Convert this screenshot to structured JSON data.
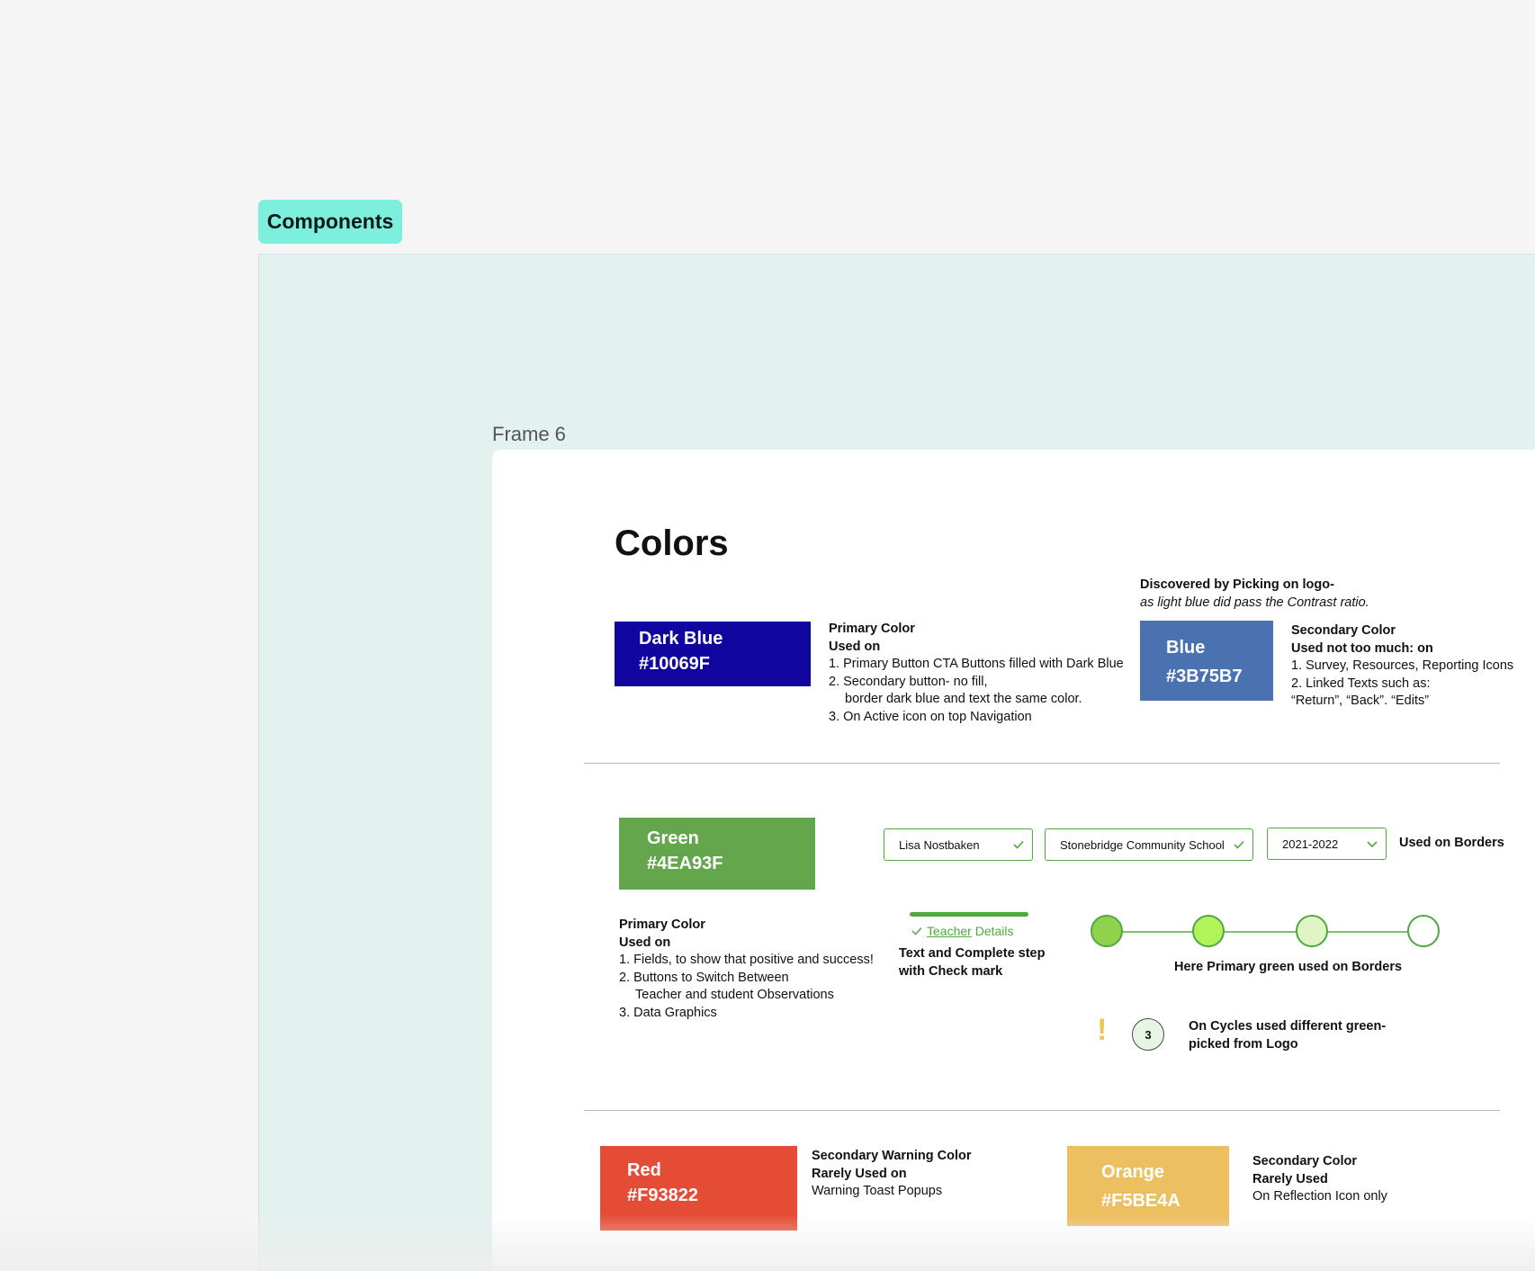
{
  "canvas": {
    "section_label": "Components",
    "frame_label": "Frame 6"
  },
  "page": {
    "title": "Colors"
  },
  "dark_blue": {
    "name": "Dark Blue",
    "hex": "#10069F",
    "notes": {
      "line1": "Primary Color",
      "line2": "Used on",
      "line3": "1. Primary Button CTA Buttons filled with Dark Blue",
      "line4": "2. Secondary button- no fill,",
      "line5": "border dark blue and text the same color.",
      "line6": "3. On Active icon on top Navigation"
    }
  },
  "blue": {
    "name": "Blue",
    "hex": "#3B75B7",
    "discovered_title": "Discovered by Picking on logo-",
    "discovered_note": "as light blue did pass the Contrast ratio.",
    "notes": {
      "line1": "Secondary Color",
      "line2": "Used not too much: on",
      "line3": "1. Survey, Resources, Reporting Icons",
      "line4": "2. Linked Texts such as:",
      "line5": "“Return”, “Back”. “Edits”"
    }
  },
  "green": {
    "name": "Green",
    "hex": "#4EA93F",
    "notes": {
      "line1": "Primary Color",
      "line2": "Used on",
      "line3": "1. Fields, to show that positive and success!",
      "line4": "2. Buttons to Switch Between",
      "line5": "Teacher and student Observations",
      "line6": "3. Data Graphics"
    },
    "dropdowns": [
      {
        "value": "Lisa Nostbaken",
        "icon": "check-icon"
      },
      {
        "value": "Stonebridge Community School",
        "icon": "check-icon"
      },
      {
        "value": "2021-2022",
        "icon": "chevron-down-icon"
      }
    ],
    "borders_label": "Used on Borders",
    "step_tab": {
      "link": "Teacher",
      "rest": " Details"
    },
    "step_caption": {
      "line1": "Text and Complete step",
      "line2": "with Check mark"
    },
    "stepper_caption": "Here Primary green used on Borders",
    "stepper_fills": [
      "#8fd24e",
      "#b2f25a",
      "#dff5c6",
      "#ffffff"
    ],
    "exclamation": "!",
    "cycle_number": "3",
    "cycles_note": {
      "line1": "On Cycles used different green-",
      "line2": "picked from Logo"
    }
  },
  "red": {
    "name": "Red",
    "hex": "#F93822",
    "notes": {
      "line1": "Secondary Warning Color",
      "line2": "Rarely Used on",
      "line3": "Warning Toast Popups"
    }
  },
  "orange": {
    "name": "Orange",
    "hex": "#F5BE4A",
    "notes": {
      "line1": "Secondary Color",
      "line2": "Rarely Used",
      "line3": "On Reflection Icon only"
    }
  },
  "colors": {
    "badge_bg": "#7eeedd",
    "section_bg": "#e3f1ef",
    "dark_blue_display": "#10069f",
    "blue_display": "#4a72b0",
    "green_display": "#63a64b",
    "red_display": "#e54c36",
    "orange_display": "#ecc061",
    "warning_icon": "#f0c556"
  }
}
